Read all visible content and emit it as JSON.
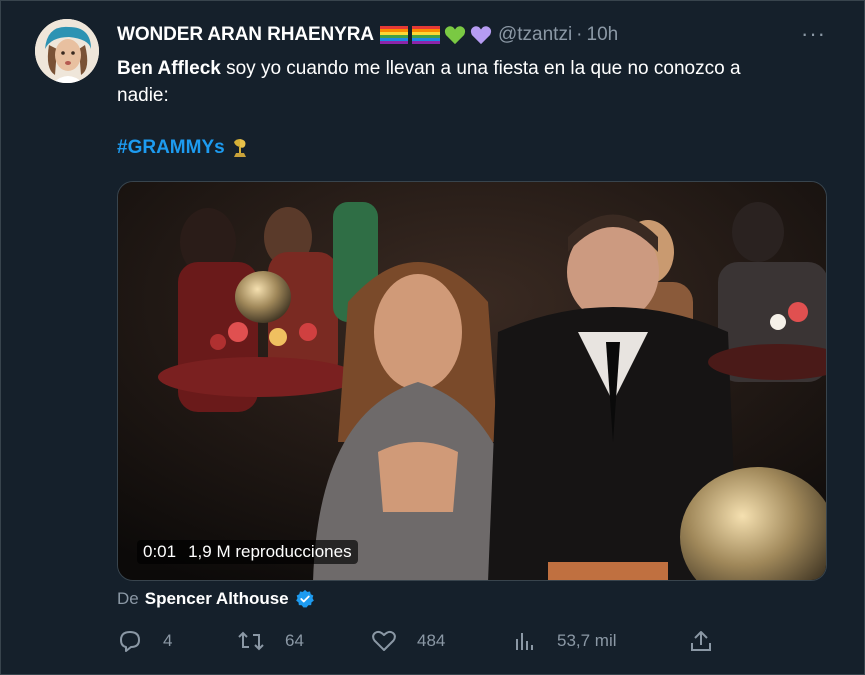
{
  "tweet": {
    "author_name": "WONDER ARAN RHAENYRA",
    "name_emojis": [
      "rainbow-flag",
      "rainbow-flag",
      "green-heart",
      "purple-heart"
    ],
    "handle": "@tzantzi",
    "separator": "·",
    "time": "10h",
    "more_label": "···",
    "mention": "Ben Affleck",
    "text_line1": " soy yo cuando me llevan a una fiesta en la que no conozco a",
    "text_line2": "nadie:",
    "hashtag": "#GRAMMYs"
  },
  "video": {
    "timestamp": "0:01",
    "views": "1,9 M reproducciones"
  },
  "source": {
    "label": "De",
    "author": "Spencer Althouse",
    "verified": true
  },
  "actions": {
    "replies": "4",
    "retweets": "64",
    "likes": "484",
    "views": "53,7 mil"
  },
  "colors": {
    "background": "#15202b",
    "accent": "#1d9bf0",
    "muted": "#8b98a5",
    "border": "#38444d"
  }
}
